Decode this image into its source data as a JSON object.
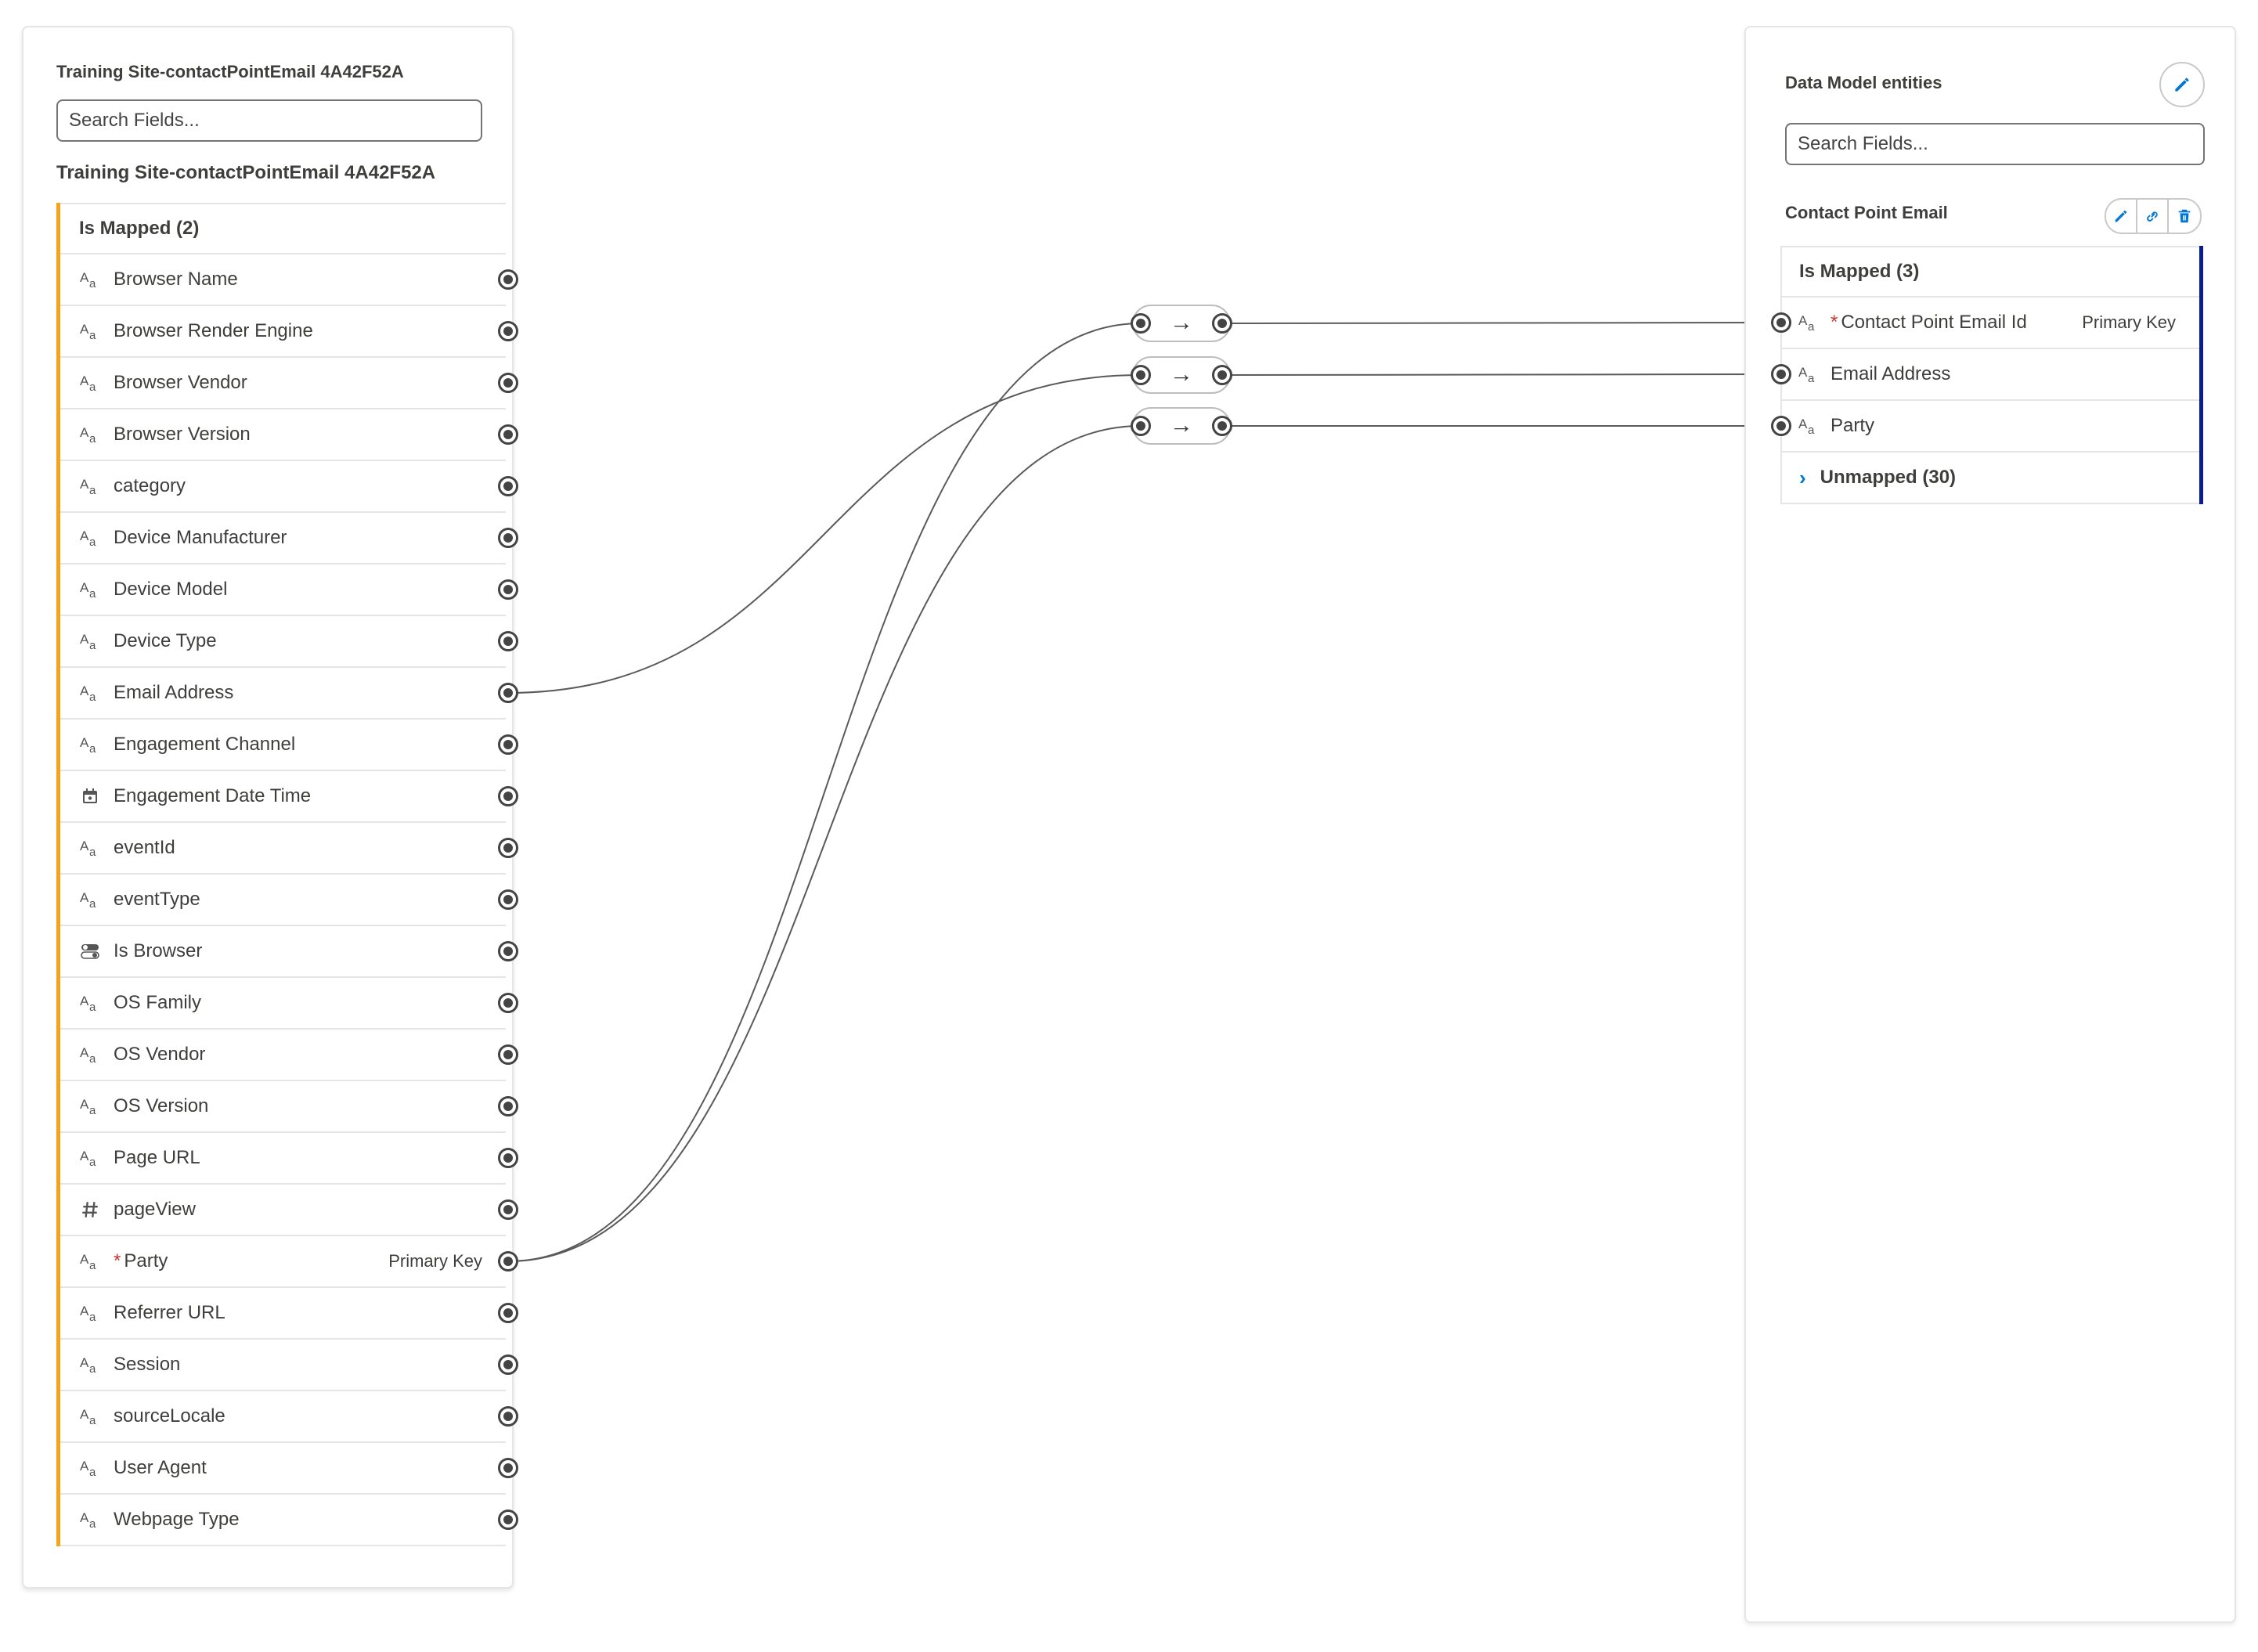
{
  "source": {
    "panel_title": "Training Site-contactPointEmail 4A42F52A",
    "search_placeholder": "Search Fields...",
    "object_title": "Training Site-contactPointEmail 4A42F52A",
    "group_label": "Is Mapped (2)",
    "fields": [
      {
        "label": "Browser Name",
        "icon": "text-type-icon"
      },
      {
        "label": "Browser Render Engine",
        "icon": "text-type-icon"
      },
      {
        "label": "Browser Vendor",
        "icon": "text-type-icon"
      },
      {
        "label": "Browser Version",
        "icon": "text-type-icon"
      },
      {
        "label": "category",
        "icon": "text-type-icon"
      },
      {
        "label": "Device Manufacturer",
        "icon": "text-type-icon"
      },
      {
        "label": "Device Model",
        "icon": "text-type-icon"
      },
      {
        "label": "Device Type",
        "icon": "text-type-icon"
      },
      {
        "label": "Email Address",
        "icon": "text-type-icon"
      },
      {
        "label": "Engagement Channel",
        "icon": "text-type-icon"
      },
      {
        "label": "Engagement Date Time",
        "icon": "calendar-type-icon"
      },
      {
        "label": "eventId",
        "icon": "text-type-icon"
      },
      {
        "label": "eventType",
        "icon": "text-type-icon"
      },
      {
        "label": "Is Browser",
        "icon": "toggle-type-icon"
      },
      {
        "label": "OS Family",
        "icon": "text-type-icon"
      },
      {
        "label": "OS Vendor",
        "icon": "text-type-icon"
      },
      {
        "label": "OS Version",
        "icon": "text-type-icon"
      },
      {
        "label": "Page URL",
        "icon": "text-type-icon"
      },
      {
        "label": "pageView",
        "icon": "number-type-icon"
      },
      {
        "label": "Party",
        "icon": "text-type-icon",
        "required_marker": "*",
        "badge": "Primary Key"
      },
      {
        "label": "Referrer URL",
        "icon": "text-type-icon"
      },
      {
        "label": "Session",
        "icon": "text-type-icon"
      },
      {
        "label": "sourceLocale",
        "icon": "text-type-icon"
      },
      {
        "label": "User Agent",
        "icon": "text-type-icon"
      },
      {
        "label": "Webpage Type",
        "icon": "text-type-icon"
      }
    ]
  },
  "target": {
    "panel_title": "Data Model entities",
    "search_placeholder": "Search Fields...",
    "object_title": "Contact Point Email",
    "group_label": "Is Mapped (3)",
    "fields": [
      {
        "label": "Contact Point Email Id",
        "icon": "text-type-icon",
        "required_marker": "*",
        "badge": "Primary Key"
      },
      {
        "label": "Email Address",
        "icon": "text-type-icon"
      },
      {
        "label": "Party",
        "icon": "text-type-icon"
      }
    ],
    "unmapped_label": "Unmapped (30)"
  },
  "mappings": [
    {
      "from": "Party",
      "to": "Contact Point Email Id"
    },
    {
      "from": "Email Address",
      "to": "Email Address"
    },
    {
      "from": "Party",
      "to": "Party"
    }
  ],
  "colors": {
    "source_accent": "#f6a31c",
    "target_accent": "#0b1d8e",
    "brand_blue": "#0176d3",
    "required_red": "#c23934"
  }
}
